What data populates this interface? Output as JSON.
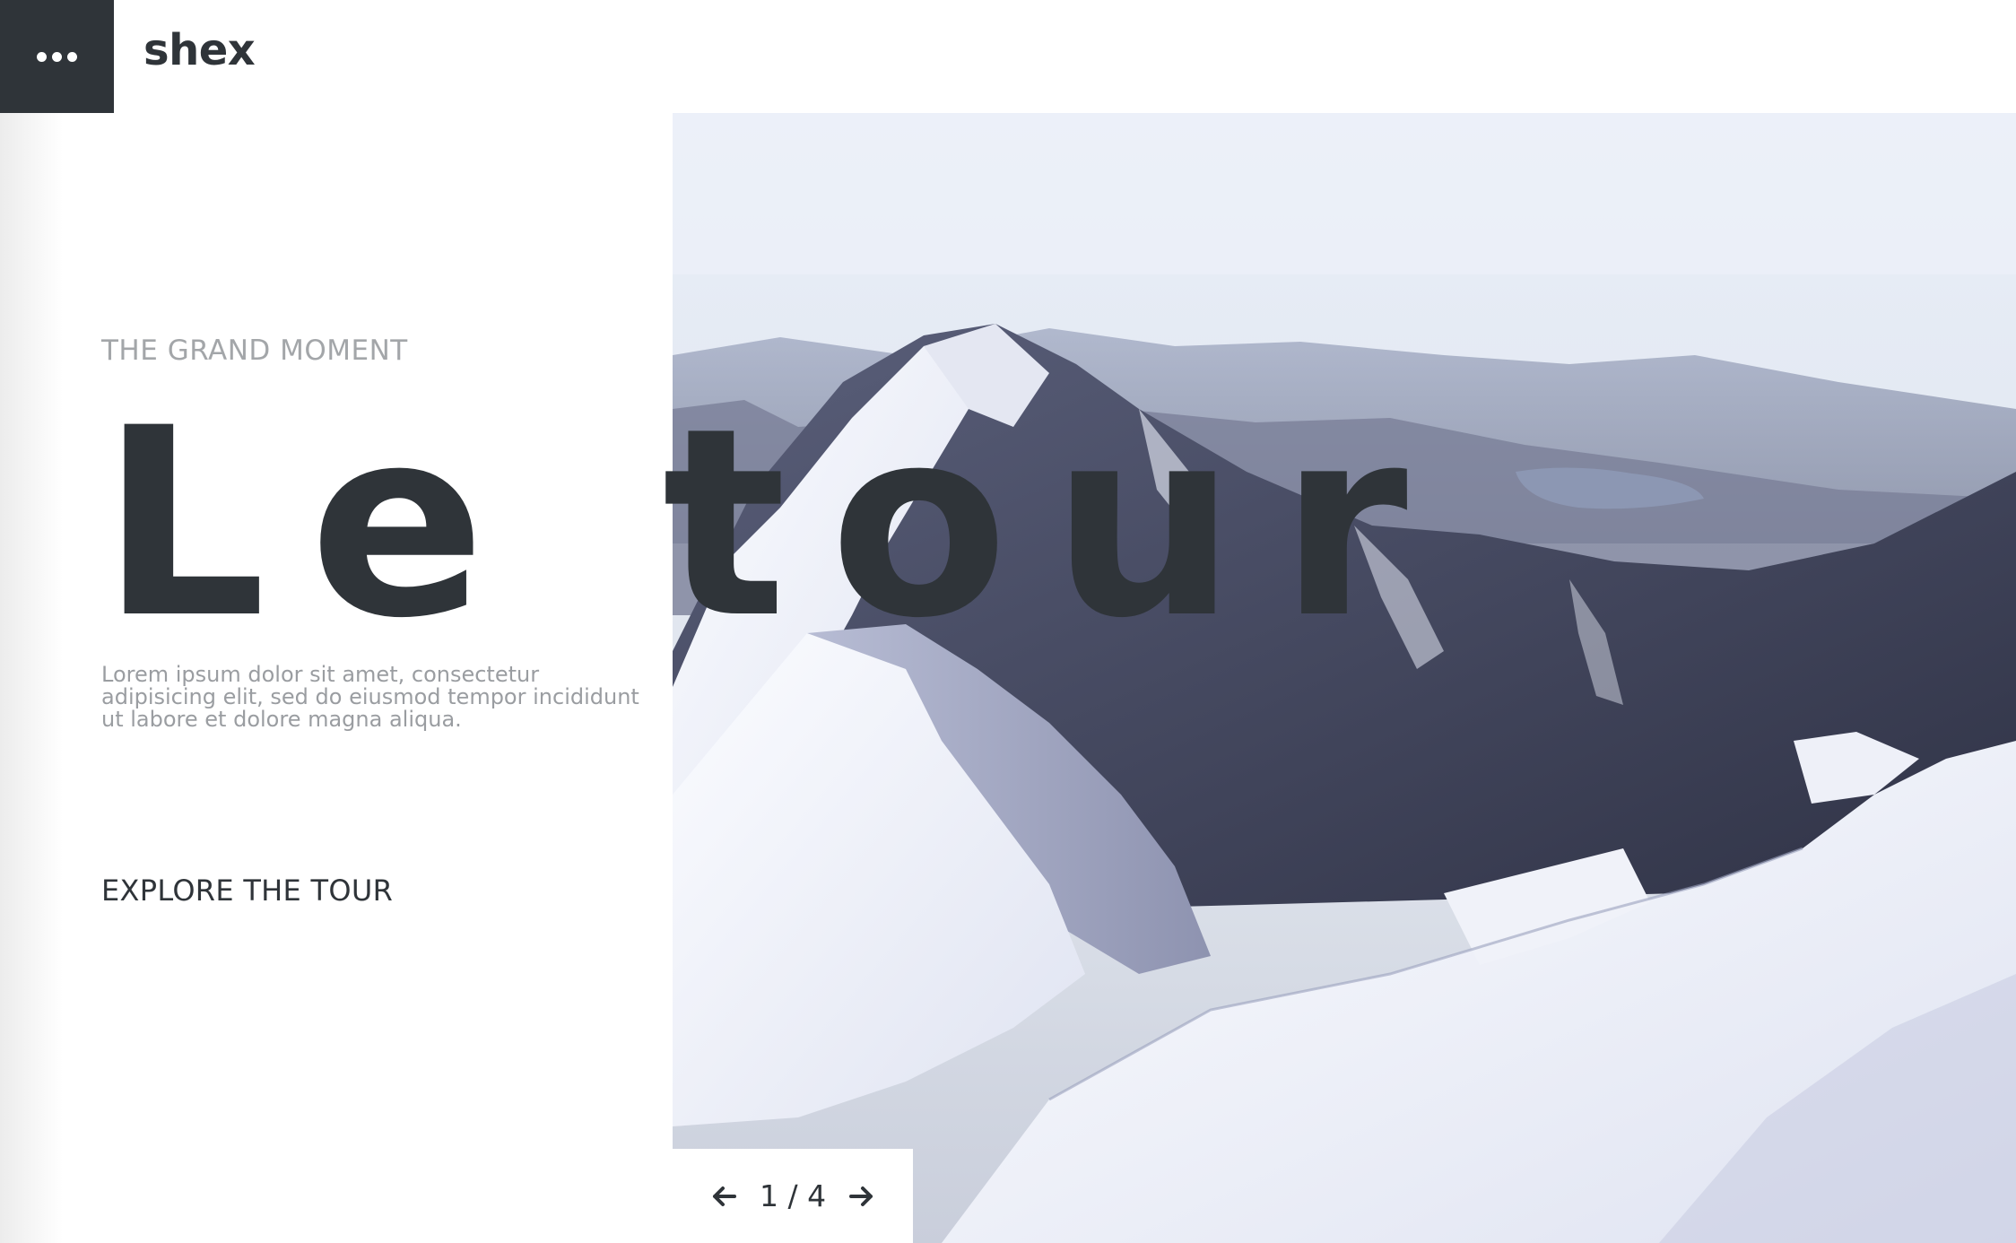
{
  "header": {
    "menu_icon": "more-dots-icon",
    "brand": "shex"
  },
  "hero": {
    "eyebrow": "THE GRAND MOMENT",
    "title": "Le tour",
    "description": "Lorem ipsum dolor sit amet, consectetur adipisicing elit, sed do eiusmod tempor incididunt ut labore et dolore magna aliqua.",
    "cta_label": "EXPLORE THE TOUR",
    "image": "snowy-mountain-range"
  },
  "pager": {
    "prev_icon": "arrow-left-icon",
    "next_icon": "arrow-right-icon",
    "current": "1",
    "separator": "/",
    "total": "4"
  },
  "colors": {
    "dark": "#2f3439",
    "muted": "#a3a6a9",
    "background": "#ffffff",
    "sky": "#e6ecf4",
    "snow": "#f3f4fa",
    "rock": "#3d4053"
  }
}
